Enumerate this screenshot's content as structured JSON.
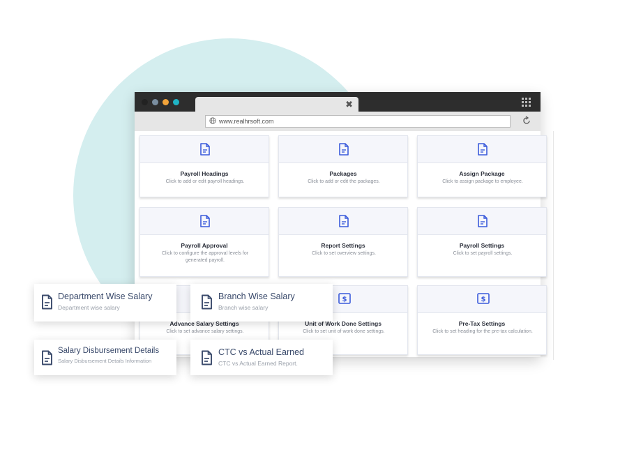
{
  "browser": {
    "window_dots": [
      "#222222",
      "#7a8ea0",
      "#f2a33a",
      "#1fb3c4"
    ],
    "tab_close": "✖",
    "url": "www.realhrsoft.com",
    "icons": {
      "window": "app-grid-icon",
      "address": "globe-icon",
      "reload": "reload-icon"
    }
  },
  "cards": [
    {
      "title": "Payroll Headings",
      "desc": "Click to add or edit payroll headings.",
      "icon": "document-icon"
    },
    {
      "title": "Packages",
      "desc": "Click to add or edit the packages.",
      "icon": "document-icon"
    },
    {
      "title": "Assign Package",
      "desc": "Click to assign package to employee.",
      "icon": "document-icon"
    },
    {
      "title": "Payroll Approval",
      "desc": "Click to configure the approval levels for generated payroll.",
      "icon": "document-icon"
    },
    {
      "title": "Report Settings",
      "desc": "Click to set overview settings.",
      "icon": "document-icon"
    },
    {
      "title": "Payroll Settings",
      "desc": "Click to set payroll settings.",
      "icon": "document-icon"
    },
    {
      "title": "Advance Salary Settings",
      "desc": "Click to set advance salary settings.",
      "icon": "dollar-icon"
    },
    {
      "title": "Unit of Work Done Settings",
      "desc": "Click to set unit of work done settings.",
      "icon": "dollar-icon"
    },
    {
      "title": "Pre-Tax Settings",
      "desc": "Click to set heading for the pre-tax calculation.",
      "icon": "dollar-icon"
    }
  ],
  "reports": [
    {
      "title": "Department Wise Salary",
      "sub": "Department wise salary",
      "icon": "report-icon"
    },
    {
      "title": "Branch Wise Salary",
      "sub": "Branch wise salary",
      "icon": "report-icon"
    },
    {
      "title": "Salary Disbursement Details",
      "sub": "Salary Disbursement Details Information",
      "icon": "report-icon"
    },
    {
      "title": "CTC vs Actual Earned",
      "sub": "CTC vs Actual Earned Report.",
      "icon": "report-icon"
    }
  ],
  "colors": {
    "accent": "#3b5bdb",
    "backdrop": "#d4eeef",
    "report_icon": "#3a4a6b"
  }
}
